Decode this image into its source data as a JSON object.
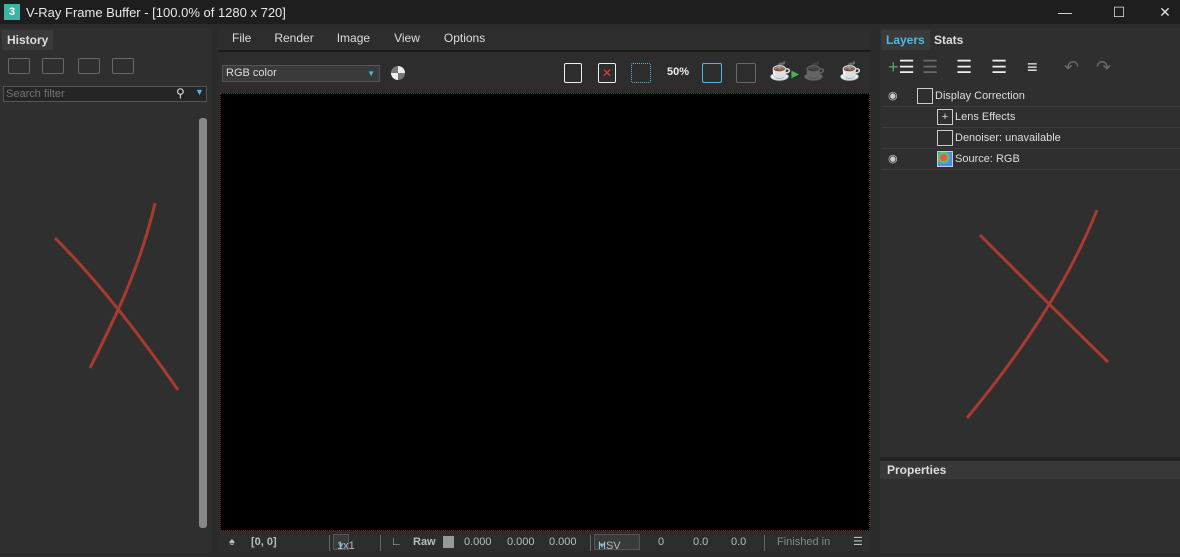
{
  "window": {
    "title": "V-Ray Frame Buffer - [100.0% of 1280 x 720]",
    "logo": "3"
  },
  "history": {
    "tab": "History",
    "search_placeholder": "Search filter"
  },
  "menu": [
    "File",
    "Render",
    "Image",
    "View",
    "Options"
  ],
  "channel": {
    "selected": "RGB color"
  },
  "right_tabs": [
    "Layers",
    "Stats"
  ],
  "layers": [
    {
      "label": "Display Correction",
      "visible": true
    },
    {
      "label": "Lens Effects",
      "visible": false
    },
    {
      "label": "Denoiser: unavailable",
      "visible": false
    },
    {
      "label": "Source: RGB",
      "visible": true
    }
  ],
  "properties": {
    "title": "Properties"
  },
  "status": {
    "coords": "[0, 0]",
    "zoom": "1x1",
    "raw": "Raw",
    "r": "0.000",
    "g": "0.000",
    "b": "0.000",
    "mode": "HSV",
    "h": "0",
    "s": "0.0",
    "v": "0.0",
    "finished": "Finished in"
  },
  "colors": {
    "annotation": "#a83a30",
    "accent": "#4db8e8"
  }
}
